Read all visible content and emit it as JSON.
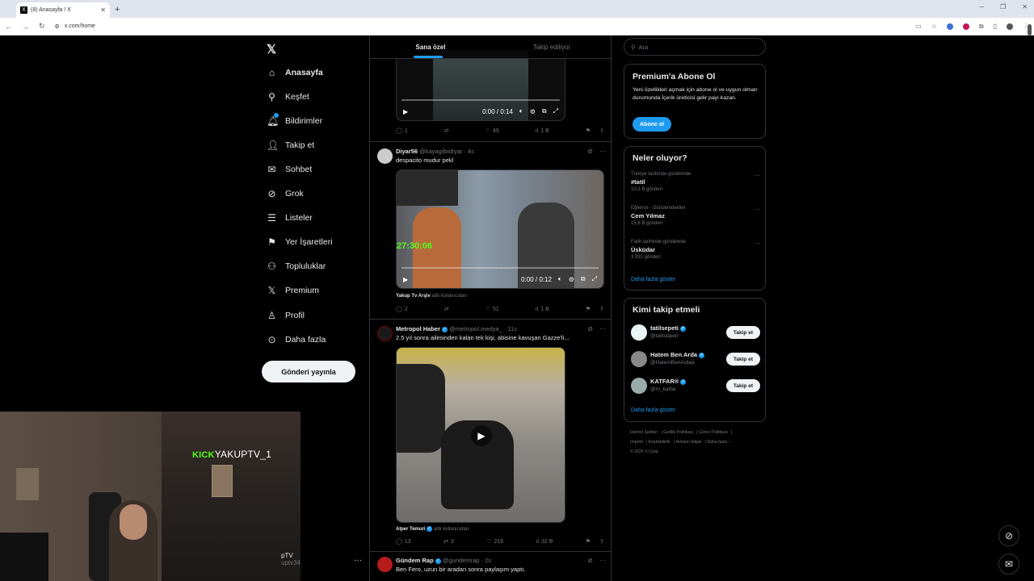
{
  "browser": {
    "tab_title": "(8) Anasayfa / X",
    "url": "x.com/home"
  },
  "nav": {
    "items": [
      {
        "label": "Anasayfa",
        "icon": "home-icon",
        "glyph": "⌂"
      },
      {
        "label": "Keşfet",
        "icon": "search-icon",
        "glyph": "⚲"
      },
      {
        "label": "Bildirimler",
        "icon": "bell-icon",
        "glyph": "🔔︎"
      },
      {
        "label": "Takip et",
        "icon": "person-add-icon",
        "glyph": "👤︎"
      },
      {
        "label": "Sohbet",
        "icon": "mail-icon",
        "glyph": "✉"
      },
      {
        "label": "Grok",
        "icon": "grok-icon",
        "glyph": "⊘"
      },
      {
        "label": "Listeler",
        "icon": "list-icon",
        "glyph": "☰"
      },
      {
        "label": "Yer İşaretleri",
        "icon": "bookmark-icon",
        "glyph": "⚑"
      },
      {
        "label": "Topluluklar",
        "icon": "communities-icon",
        "glyph": "⚇"
      },
      {
        "label": "Premium",
        "icon": "x-premium-icon",
        "glyph": "𝕏"
      },
      {
        "label": "Profil",
        "icon": "profile-icon",
        "glyph": "♙"
      },
      {
        "label": "Daha fazla",
        "icon": "more-circle-icon",
        "glyph": "⊙"
      }
    ],
    "post_button": "Gönderi yayınla",
    "profile_name": "pTV",
    "profile_handle": "uptv34"
  },
  "stream_overlay": {
    "kick_label": "KICK",
    "channel": "YAKUPTV_1"
  },
  "timeline": {
    "tabs": [
      "Sana özel",
      "Takip ediliyor"
    ],
    "tweet0": {
      "time": "0:00 / 0:14",
      "replies": "1",
      "likes": "49",
      "views": "1 B"
    },
    "tweet1": {
      "name": "Diyar56",
      "handle": "@kayagilbidiyar · 4s",
      "text": "despacito mudur pekl",
      "overlay_time": "27:30:06",
      "time": "0:00 / 0:12",
      "attrib_name": "Yakup Tv Arşiv",
      "attrib_suffix": "adlı kullanıcıdan",
      "replies": "2",
      "likes": "51",
      "views": "1 B"
    },
    "tweet2": {
      "name": "Metropol Haber",
      "handle": "@metropol.medya_ · 11s",
      "text": "2.5 yıl sonra ailesinden kalan tek kişi, abisine kavuşan Gazze'li...",
      "attrib_name": "Alper Temuri",
      "attrib_suffix": "adlı kullanıcıdan",
      "replies": "13",
      "retweets": "3",
      "likes": "216",
      "views": "32 B"
    },
    "tweet3": {
      "name": "Gündem Rap",
      "handle": "@gundemrap · 2s",
      "text": "Ben Fero, uzun bir aradan sonra paylaşım yaptı."
    }
  },
  "right": {
    "search_placeholder": "Ara",
    "premium": {
      "title": "Premium'a Abone Ol",
      "desc": "Yeni özellikleri açmak için abone ol ve uygun olman durumunda İçerik üreticisi gelir payı kazan.",
      "button": "Abone ol"
    },
    "trends": {
      "title": "Neler oluyor?",
      "items": [
        {
          "ctx": "Türkiye tarihinde gündemde",
          "name": "#tatil",
          "count": "10,2 B gönderi"
        },
        {
          "ctx": "Eğlence · Gündemdekiler",
          "name": "Cem Yılmaz",
          "count": "15,6 B gönderi"
        },
        {
          "ctx": "Fatih tarihinde gündemde",
          "name": "Üsküdar",
          "count": "3.931 gönderi"
        }
      ],
      "more": "Daha fazla göster"
    },
    "who_to_follow": {
      "title": "Kimi takip etmeli",
      "items": [
        {
          "name": "tatilsepeti",
          "handle": "@tatilsepeti",
          "button": "Takip et"
        },
        {
          "name": "Hatem Ben Arda",
          "handle": "@HatemBenArdaa",
          "button": "Takip et"
        },
        {
          "name": "KATFAR®",
          "handle": "@m_katfar",
          "button": "Takip et"
        }
      ],
      "more": "Daha fazla göster"
    },
    "footer": {
      "line1": [
        "Hizmet Şartları",
        "Gizlilik Politikası",
        "Çerez Politikası"
      ],
      "line2": [
        "Imprint",
        "Erişilebilirlik",
        "Reklam bilgisi",
        "Daha fazla ···"
      ],
      "copyright": "© 2025 X Corp."
    }
  },
  "colors": {
    "accent": "#1d9bf0",
    "kick_green": "#53fc18"
  }
}
